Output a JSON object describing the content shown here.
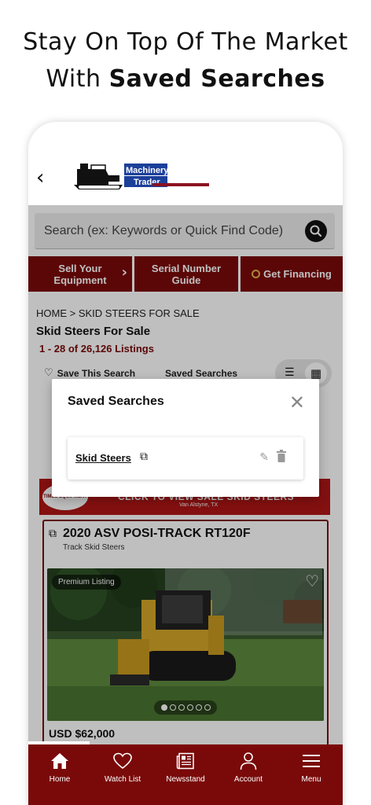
{
  "headline": {
    "line1": "Stay On Top Of The Market",
    "line2_prefix": "With ",
    "line2_bold": "Saved Searches"
  },
  "header": {
    "back_icon": "chevron-left-icon",
    "logo_text_1": "Machinery",
    "logo_text_2": "Trader"
  },
  "search": {
    "placeholder": "Search (ex: Keywords or Quick Find Code)",
    "icon": "search-icon"
  },
  "promo": {
    "sell_line1": "Sell Your",
    "sell_line2": "Equipment",
    "serial_line1": "Serial Number",
    "serial_line2": "Guide",
    "financing": "Get Financing"
  },
  "breadcrumb": "HOME > SKID STEERS FOR SALE",
  "category_title": "Skid Steers For Sale",
  "listing_count": "1 - 28 of 26,126 Listings",
  "actions": {
    "save_search": "Save This Search",
    "saved_searches": "Saved Searches"
  },
  "ad": {
    "headline": "CLICK TO VIEW SALE SKID STEERS",
    "location": "Van Alstyne, TX",
    "logo": "TIMES EQUIPMENT"
  },
  "listing": {
    "title": "2020 ASV POSI-TRACK RT120F",
    "subtitle": "Track Skid Steers",
    "badge": "Premium Listing",
    "price": "USD $62,000",
    "photo_count": 6,
    "photo_index": 1
  },
  "modal": {
    "title": "Saved Searches",
    "close_icon": "close-icon",
    "items": [
      {
        "name": "Skid Steers"
      }
    ]
  },
  "tabs": [
    {
      "label": "Home",
      "icon": "home-icon"
    },
    {
      "label": "Watch List",
      "icon": "heart-icon"
    },
    {
      "label": "Newsstand",
      "icon": "newspaper-icon"
    },
    {
      "label": "Account",
      "icon": "user-icon"
    },
    {
      "label": "Menu",
      "icon": "menu-icon"
    }
  ],
  "colors": {
    "brand_red": "#7a0a0a",
    "ad_red": "#b11616",
    "accent_gold": "#e2b24a"
  }
}
